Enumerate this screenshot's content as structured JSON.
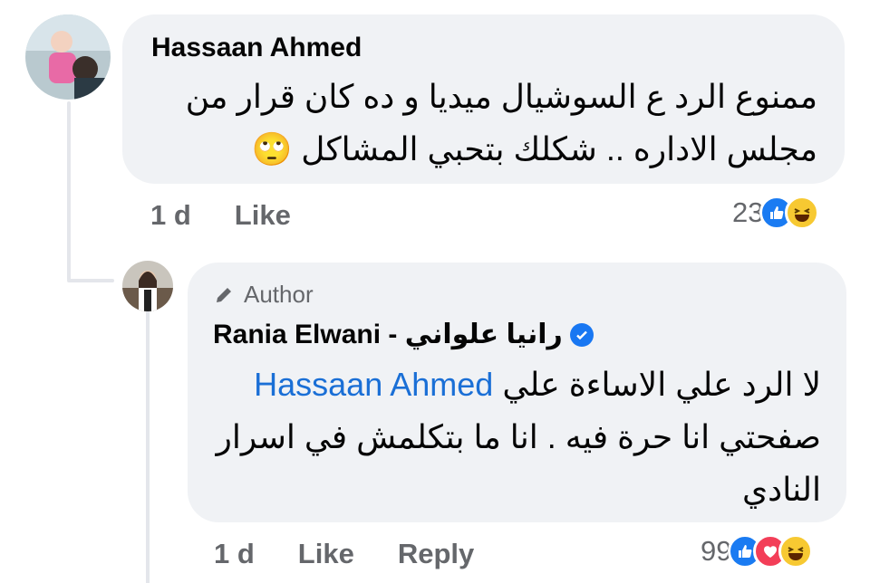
{
  "comment": {
    "author": "Hassaan Ahmed",
    "lines": [
      "ممنوع الرد ع السوشيال ميديا و ده كان قرار من",
      "مجلس الاداره .. شكلك بتحبي المشاكل 🙄"
    ],
    "time": "1 d",
    "like_label": "Like",
    "reaction_count": "23",
    "reactions": [
      "like-icon",
      "haha-icon"
    ]
  },
  "reply": {
    "badge": "Author",
    "author": "Rania Elwani - رانيا علواني",
    "mention": "Hassaan Ahmed",
    "line1_rest": "لا الرد علي الاساءة علي",
    "line2": "صفحتي انا حرة فيه . انا ما بتكلمش في اسرار",
    "line3": "النادي",
    "time": "1 d",
    "like_label": "Like",
    "reply_label": "Reply",
    "reaction_count": "99",
    "reactions": [
      "like-icon",
      "love-icon",
      "haha-icon"
    ]
  },
  "colors": {
    "bubble": "#f0f2f5",
    "meta": "#65676b",
    "link": "#1a6fd6",
    "like": "#1a7bf2",
    "love": "#f33e58",
    "haha": "#f7c932"
  }
}
